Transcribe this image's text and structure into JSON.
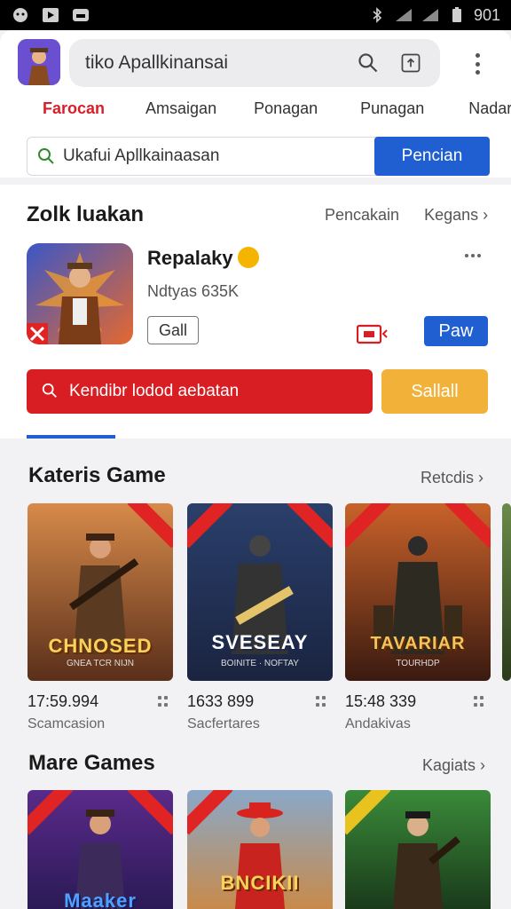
{
  "status": {
    "time": "901"
  },
  "appbar": {
    "search_query": "tiko Apallkinansai",
    "tabs": [
      "Farocan",
      "Amsaigan",
      "Ponagan",
      "Punagan",
      "Nadari"
    ],
    "search_field_text": "Ukafui Apllkainaasan",
    "search_button": "Pencian"
  },
  "featured": {
    "title": "Zolk luakan",
    "links": [
      "Pencakain",
      "Kegans"
    ],
    "app_name": "Repalaky",
    "app_meta": "Ndtyas 635K",
    "ghost_button": "Gall",
    "play_button": "Paw"
  },
  "promo": {
    "red_text": "Kendibr lodod aebatan",
    "yellow_button": "Sallall"
  },
  "section_games": {
    "title": "Kateris Game",
    "link": "Retcdis",
    "items": [
      {
        "title": "CHNOSED",
        "sub": "GNEA TCR NIJN",
        "stat": "17:59.994",
        "cat": "Scamcasion"
      },
      {
        "title": "SVESEAY",
        "sub": "BOINITE · NOFTAY",
        "stat": "1633 899",
        "cat": "Sacfertares"
      },
      {
        "title": "TAVARIAR",
        "sub": "TOURHDP",
        "stat": "15:48 339",
        "cat": "Andakivas"
      }
    ]
  },
  "section_more": {
    "title": "Mare Games",
    "link": "Kagiats",
    "items": [
      {
        "title": "Maaker"
      },
      {
        "title": "BNCIKII"
      },
      {
        "title": ""
      }
    ]
  },
  "colors": {
    "accent_blue": "#1f5fd1",
    "accent_red": "#d81d23",
    "accent_yellow": "#f2b23a"
  }
}
